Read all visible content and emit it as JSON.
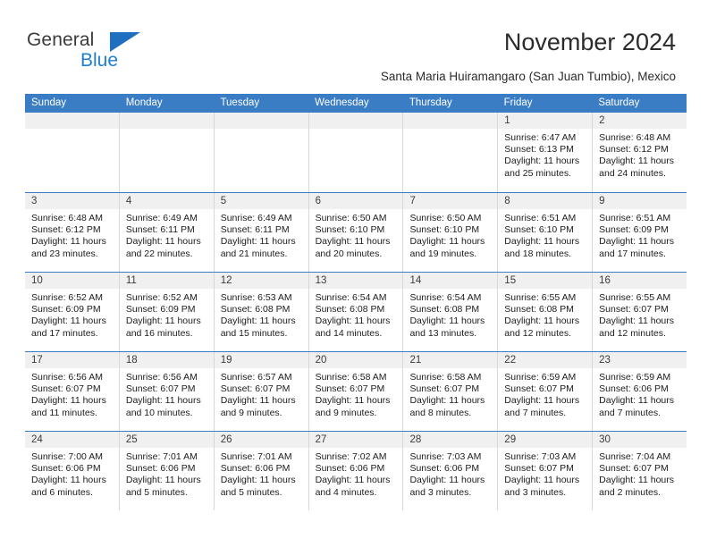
{
  "brand": {
    "logo_text_top": "General",
    "logo_text_bottom": "Blue",
    "accent_color": "#1f7ed0",
    "header_color": "#3b7dc4"
  },
  "header": {
    "title": "November 2024",
    "subtitle": "Santa Maria Huiramangaro (San Juan Tumbio), Mexico"
  },
  "calendar": {
    "weekdays": [
      "Sunday",
      "Monday",
      "Tuesday",
      "Wednesday",
      "Thursday",
      "Friday",
      "Saturday"
    ],
    "weeks": [
      [
        {
          "day": "",
          "sunrise": "",
          "sunset": "",
          "daylight": ""
        },
        {
          "day": "",
          "sunrise": "",
          "sunset": "",
          "daylight": ""
        },
        {
          "day": "",
          "sunrise": "",
          "sunset": "",
          "daylight": ""
        },
        {
          "day": "",
          "sunrise": "",
          "sunset": "",
          "daylight": ""
        },
        {
          "day": "",
          "sunrise": "",
          "sunset": "",
          "daylight": ""
        },
        {
          "day": "1",
          "sunrise": "Sunrise: 6:47 AM",
          "sunset": "Sunset: 6:13 PM",
          "daylight": "Daylight: 11 hours and 25 minutes."
        },
        {
          "day": "2",
          "sunrise": "Sunrise: 6:48 AM",
          "sunset": "Sunset: 6:12 PM",
          "daylight": "Daylight: 11 hours and 24 minutes."
        }
      ],
      [
        {
          "day": "3",
          "sunrise": "Sunrise: 6:48 AM",
          "sunset": "Sunset: 6:12 PM",
          "daylight": "Daylight: 11 hours and 23 minutes."
        },
        {
          "day": "4",
          "sunrise": "Sunrise: 6:49 AM",
          "sunset": "Sunset: 6:11 PM",
          "daylight": "Daylight: 11 hours and 22 minutes."
        },
        {
          "day": "5",
          "sunrise": "Sunrise: 6:49 AM",
          "sunset": "Sunset: 6:11 PM",
          "daylight": "Daylight: 11 hours and 21 minutes."
        },
        {
          "day": "6",
          "sunrise": "Sunrise: 6:50 AM",
          "sunset": "Sunset: 6:10 PM",
          "daylight": "Daylight: 11 hours and 20 minutes."
        },
        {
          "day": "7",
          "sunrise": "Sunrise: 6:50 AM",
          "sunset": "Sunset: 6:10 PM",
          "daylight": "Daylight: 11 hours and 19 minutes."
        },
        {
          "day": "8",
          "sunrise": "Sunrise: 6:51 AM",
          "sunset": "Sunset: 6:10 PM",
          "daylight": "Daylight: 11 hours and 18 minutes."
        },
        {
          "day": "9",
          "sunrise": "Sunrise: 6:51 AM",
          "sunset": "Sunset: 6:09 PM",
          "daylight": "Daylight: 11 hours and 17 minutes."
        }
      ],
      [
        {
          "day": "10",
          "sunrise": "Sunrise: 6:52 AM",
          "sunset": "Sunset: 6:09 PM",
          "daylight": "Daylight: 11 hours and 17 minutes."
        },
        {
          "day": "11",
          "sunrise": "Sunrise: 6:52 AM",
          "sunset": "Sunset: 6:09 PM",
          "daylight": "Daylight: 11 hours and 16 minutes."
        },
        {
          "day": "12",
          "sunrise": "Sunrise: 6:53 AM",
          "sunset": "Sunset: 6:08 PM",
          "daylight": "Daylight: 11 hours and 15 minutes."
        },
        {
          "day": "13",
          "sunrise": "Sunrise: 6:54 AM",
          "sunset": "Sunset: 6:08 PM",
          "daylight": "Daylight: 11 hours and 14 minutes."
        },
        {
          "day": "14",
          "sunrise": "Sunrise: 6:54 AM",
          "sunset": "Sunset: 6:08 PM",
          "daylight": "Daylight: 11 hours and 13 minutes."
        },
        {
          "day": "15",
          "sunrise": "Sunrise: 6:55 AM",
          "sunset": "Sunset: 6:08 PM",
          "daylight": "Daylight: 11 hours and 12 minutes."
        },
        {
          "day": "16",
          "sunrise": "Sunrise: 6:55 AM",
          "sunset": "Sunset: 6:07 PM",
          "daylight": "Daylight: 11 hours and 12 minutes."
        }
      ],
      [
        {
          "day": "17",
          "sunrise": "Sunrise: 6:56 AM",
          "sunset": "Sunset: 6:07 PM",
          "daylight": "Daylight: 11 hours and 11 minutes."
        },
        {
          "day": "18",
          "sunrise": "Sunrise: 6:56 AM",
          "sunset": "Sunset: 6:07 PM",
          "daylight": "Daylight: 11 hours and 10 minutes."
        },
        {
          "day": "19",
          "sunrise": "Sunrise: 6:57 AM",
          "sunset": "Sunset: 6:07 PM",
          "daylight": "Daylight: 11 hours and 9 minutes."
        },
        {
          "day": "20",
          "sunrise": "Sunrise: 6:58 AM",
          "sunset": "Sunset: 6:07 PM",
          "daylight": "Daylight: 11 hours and 9 minutes."
        },
        {
          "day": "21",
          "sunrise": "Sunrise: 6:58 AM",
          "sunset": "Sunset: 6:07 PM",
          "daylight": "Daylight: 11 hours and 8 minutes."
        },
        {
          "day": "22",
          "sunrise": "Sunrise: 6:59 AM",
          "sunset": "Sunset: 6:07 PM",
          "daylight": "Daylight: 11 hours and 7 minutes."
        },
        {
          "day": "23",
          "sunrise": "Sunrise: 6:59 AM",
          "sunset": "Sunset: 6:06 PM",
          "daylight": "Daylight: 11 hours and 7 minutes."
        }
      ],
      [
        {
          "day": "24",
          "sunrise": "Sunrise: 7:00 AM",
          "sunset": "Sunset: 6:06 PM",
          "daylight": "Daylight: 11 hours and 6 minutes."
        },
        {
          "day": "25",
          "sunrise": "Sunrise: 7:01 AM",
          "sunset": "Sunset: 6:06 PM",
          "daylight": "Daylight: 11 hours and 5 minutes."
        },
        {
          "day": "26",
          "sunrise": "Sunrise: 7:01 AM",
          "sunset": "Sunset: 6:06 PM",
          "daylight": "Daylight: 11 hours and 5 minutes."
        },
        {
          "day": "27",
          "sunrise": "Sunrise: 7:02 AM",
          "sunset": "Sunset: 6:06 PM",
          "daylight": "Daylight: 11 hours and 4 minutes."
        },
        {
          "day": "28",
          "sunrise": "Sunrise: 7:03 AM",
          "sunset": "Sunset: 6:06 PM",
          "daylight": "Daylight: 11 hours and 3 minutes."
        },
        {
          "day": "29",
          "sunrise": "Sunrise: 7:03 AM",
          "sunset": "Sunset: 6:07 PM",
          "daylight": "Daylight: 11 hours and 3 minutes."
        },
        {
          "day": "30",
          "sunrise": "Sunrise: 7:04 AM",
          "sunset": "Sunset: 6:07 PM",
          "daylight": "Daylight: 11 hours and 2 minutes."
        }
      ]
    ]
  }
}
